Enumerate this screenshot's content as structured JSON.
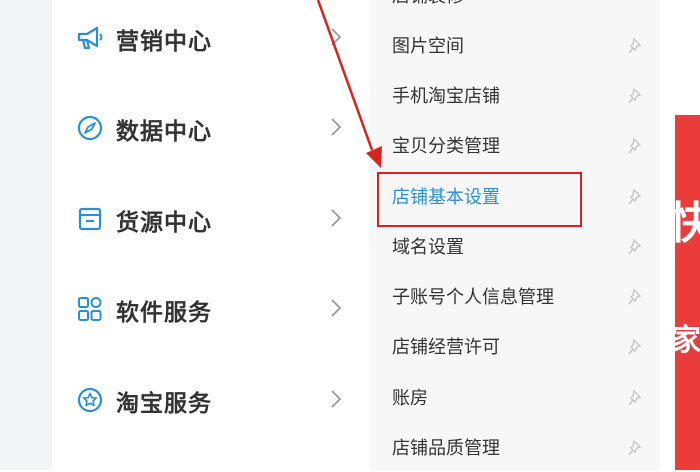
{
  "nav": {
    "items": [
      {
        "label": "营销中心",
        "icon": "megaphone-icon"
      },
      {
        "label": "数据中心",
        "icon": "compass-icon"
      },
      {
        "label": "货源中心",
        "icon": "archive-box-icon"
      },
      {
        "label": "软件服务",
        "icon": "grid-apps-icon"
      },
      {
        "label": "淘宝服务",
        "icon": "star-circle-icon"
      }
    ]
  },
  "submenu": {
    "items": [
      {
        "label": "店铺装修",
        "pinned": false
      },
      {
        "label": "图片空间",
        "pinned": false
      },
      {
        "label": "手机淘宝店铺",
        "pinned": false
      },
      {
        "label": "宝贝分类管理",
        "pinned": false
      },
      {
        "label": "店铺基本设置",
        "pinned": false,
        "active": true
      },
      {
        "label": "域名设置",
        "pinned": false
      },
      {
        "label": "子账号个人信息管理",
        "pinned": false
      },
      {
        "label": "店铺经营许可",
        "pinned": false
      },
      {
        "label": "账房",
        "pinned": false
      },
      {
        "label": "店铺品质管理",
        "pinned": false
      }
    ]
  },
  "banner": {
    "char1": "快",
    "char2": "家"
  },
  "colors": {
    "accent_blue": "#2a8fd6",
    "annotation_red": "#d9231d",
    "banner_red": "#ea3d3b"
  }
}
